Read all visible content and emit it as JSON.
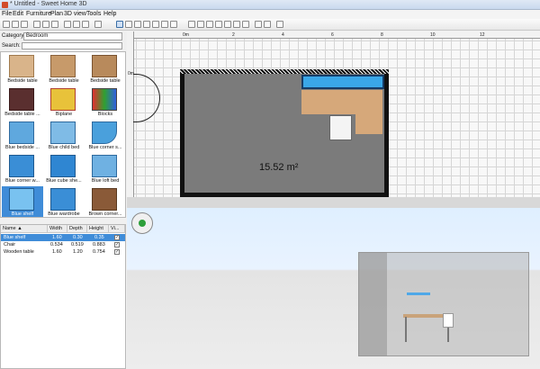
{
  "window": {
    "title": "* Untitled - Sweet Home 3D"
  },
  "menu": [
    "File",
    "Edit",
    "Furniture",
    "Plan",
    "3D view",
    "Tools",
    "Help"
  ],
  "catalog": {
    "category_label": "Category:",
    "category_value": "Bedroom",
    "search_label": "Search:",
    "items": [
      "Bedside table",
      "Bedside table",
      "Bedside table",
      "Bedside table ...",
      "Biplane",
      "Blocks",
      "Blue bedside ...",
      "Blue child bed",
      "Blue corner s...",
      "Blue corner w...",
      "Blue cube she...",
      "Blue loft bed",
      "Blue shelf",
      "Blue wardrobe",
      "Brown corner..."
    ],
    "selected_item": "Blue shelf"
  },
  "furniture_table": {
    "columns": [
      "Name",
      "Width",
      "Depth",
      "Height",
      "Vi..."
    ],
    "rows": [
      {
        "name": "Blue shelf",
        "width": "1.60",
        "depth": "0.30",
        "height": "0.35",
        "visible": true,
        "selected": true
      },
      {
        "name": "Chair",
        "width": "0.534",
        "depth": "0.519",
        "height": "0.883",
        "visible": true,
        "selected": false
      },
      {
        "name": "Wooden table",
        "width": "1.60",
        "depth": "1.20",
        "height": "0.754",
        "visible": true,
        "selected": false
      }
    ]
  },
  "plan": {
    "ruler_labels": [
      "0m",
      "2",
      "4",
      "6",
      "8",
      "10",
      "12"
    ],
    "left_ruler_label": "0m",
    "room_area": "15.52 m²"
  }
}
